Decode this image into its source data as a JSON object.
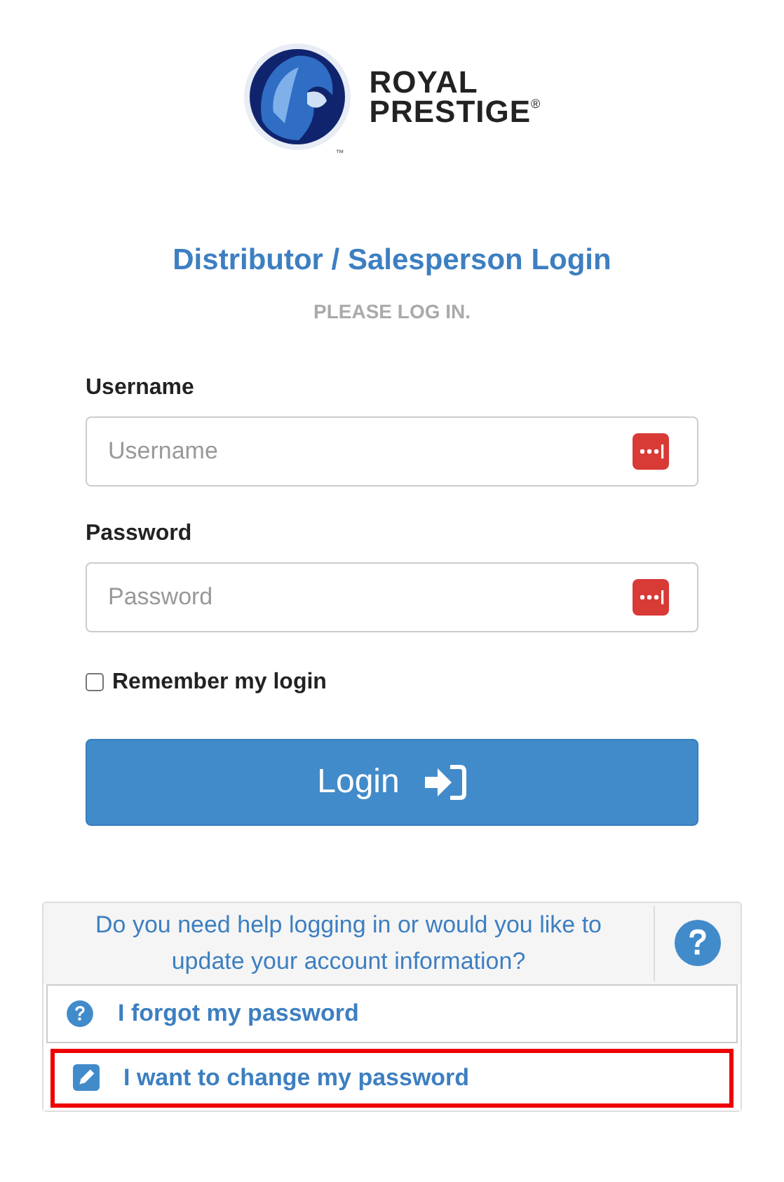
{
  "logo": {
    "line_1": "ROYAL",
    "line_2": "PRESTIGE",
    "registered": "®",
    "trademark": "™"
  },
  "title": "Distributor / Salesperson Login",
  "subtitle": "PLEASE LOG IN.",
  "fields": [
    {
      "label": "Username",
      "placeholder": "Username"
    },
    {
      "label": "Password",
      "placeholder": "Password"
    }
  ],
  "remember": {
    "label": "Remember my login",
    "checked": false
  },
  "login_button": "Login",
  "help": {
    "text": "Do you need help logging in or would you like to update your account information?",
    "links": [
      {
        "kind": "question",
        "label": "I forgot my password",
        "highlighted": false
      },
      {
        "kind": "edit",
        "label": "I want to change my password",
        "highlighted": true
      }
    ]
  }
}
